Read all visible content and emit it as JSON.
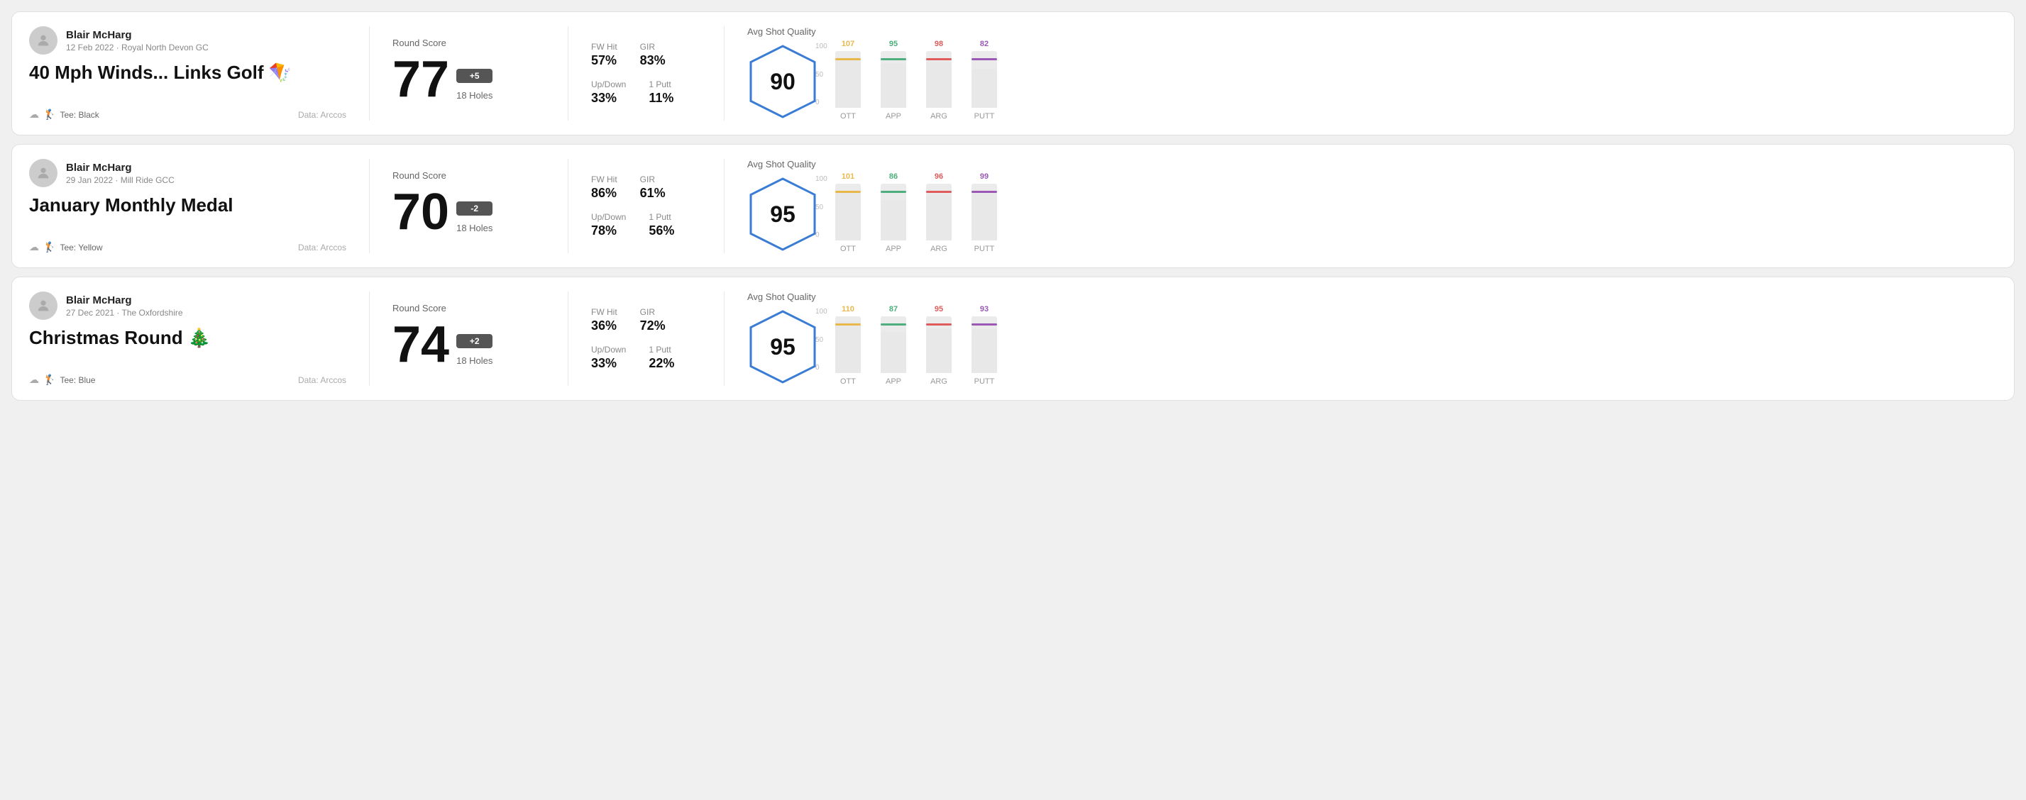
{
  "rounds": [
    {
      "id": "round-1",
      "player": "Blair McHarg",
      "date_course": "12 Feb 2022 · Royal North Devon GC",
      "title": "40 Mph Winds... Links Golf 🪁",
      "tee": "Black",
      "data_source": "Data: Arccos",
      "round_score_label": "Round Score",
      "score": "77",
      "score_diff": "+5",
      "holes": "18 Holes",
      "fw_hit_label": "FW Hit",
      "fw_hit_value": "57%",
      "gir_label": "GIR",
      "gir_value": "83%",
      "updown_label": "Up/Down",
      "updown_value": "33%",
      "oneputt_label": "1 Putt",
      "oneputt_value": "11%",
      "avg_sq_label": "Avg Shot Quality",
      "sq_score": "90",
      "bars": [
        {
          "label": "OTT",
          "value": 107,
          "color": "#e8b84b"
        },
        {
          "label": "APP",
          "value": 95,
          "color": "#4caf7d"
        },
        {
          "label": "ARG",
          "value": 98,
          "color": "#e05c5c"
        },
        {
          "label": "PUTT",
          "value": 82,
          "color": "#9b59b6"
        }
      ]
    },
    {
      "id": "round-2",
      "player": "Blair McHarg",
      "date_course": "29 Jan 2022 · Mill Ride GCC",
      "title": "January Monthly Medal",
      "tee": "Yellow",
      "data_source": "Data: Arccos",
      "round_score_label": "Round Score",
      "score": "70",
      "score_diff": "-2",
      "holes": "18 Holes",
      "fw_hit_label": "FW Hit",
      "fw_hit_value": "86%",
      "gir_label": "GIR",
      "gir_value": "61%",
      "updown_label": "Up/Down",
      "updown_value": "78%",
      "oneputt_label": "1 Putt",
      "oneputt_value": "56%",
      "avg_sq_label": "Avg Shot Quality",
      "sq_score": "95",
      "bars": [
        {
          "label": "OTT",
          "value": 101,
          "color": "#e8b84b"
        },
        {
          "label": "APP",
          "value": 86,
          "color": "#4caf7d"
        },
        {
          "label": "ARG",
          "value": 96,
          "color": "#e05c5c"
        },
        {
          "label": "PUTT",
          "value": 99,
          "color": "#9b59b6"
        }
      ]
    },
    {
      "id": "round-3",
      "player": "Blair McHarg",
      "date_course": "27 Dec 2021 · The Oxfordshire",
      "title": "Christmas Round 🎄",
      "tee": "Blue",
      "data_source": "Data: Arccos",
      "round_score_label": "Round Score",
      "score": "74",
      "score_diff": "+2",
      "holes": "18 Holes",
      "fw_hit_label": "FW Hit",
      "fw_hit_value": "36%",
      "gir_label": "GIR",
      "gir_value": "72%",
      "updown_label": "Up/Down",
      "updown_value": "33%",
      "oneputt_label": "1 Putt",
      "oneputt_value": "22%",
      "avg_sq_label": "Avg Shot Quality",
      "sq_score": "95",
      "bars": [
        {
          "label": "OTT",
          "value": 110,
          "color": "#e8b84b"
        },
        {
          "label": "APP",
          "value": 87,
          "color": "#4caf7d"
        },
        {
          "label": "ARG",
          "value": 95,
          "color": "#e05c5c"
        },
        {
          "label": "PUTT",
          "value": 93,
          "color": "#9b59b6"
        }
      ]
    }
  ]
}
